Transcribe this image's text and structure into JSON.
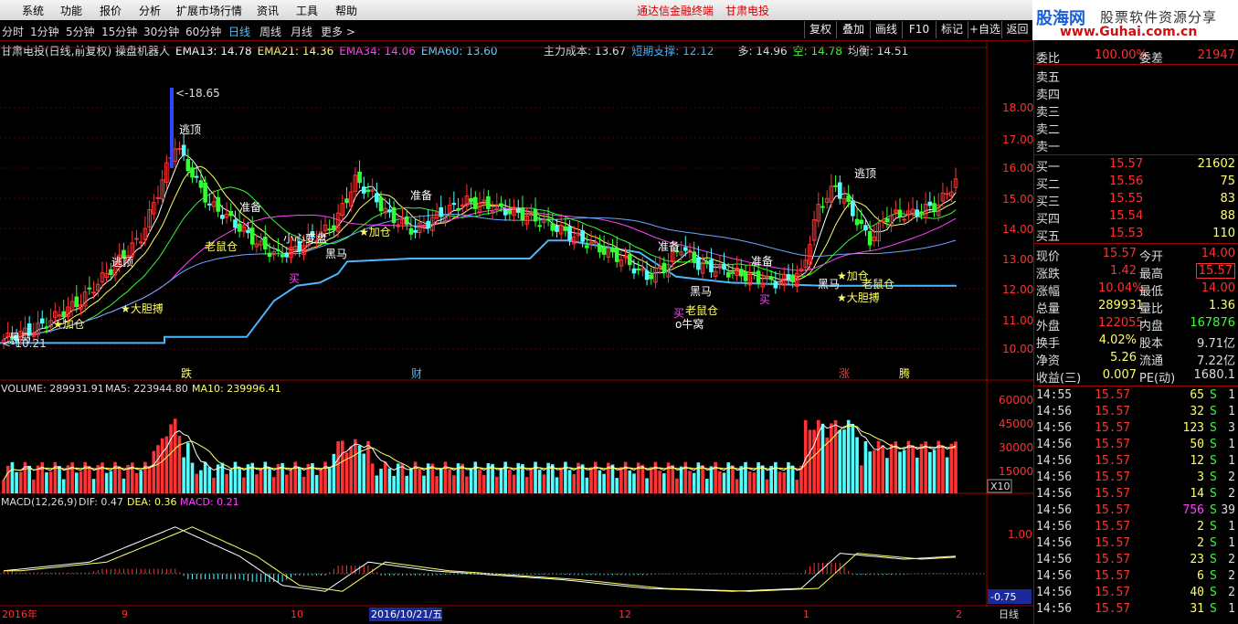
{
  "menu": {
    "items": [
      "系统",
      "功能",
      "报价",
      "分析",
      "扩展市场行情",
      "资讯",
      "工具",
      "帮助"
    ],
    "headline_left": "通达信金融终端",
    "headline_right": "甘肃电投"
  },
  "logo": {
    "brand": "股海网",
    "slogan": "股票软件资源分享",
    "url_text": "www.Guhai.com.cn"
  },
  "timeframes": [
    "分时",
    "1分钟",
    "5分钟",
    "15分钟",
    "30分钟",
    "60分钟",
    "日线",
    "周线",
    "月线",
    "更多 >"
  ],
  "active_timeframe": "日线",
  "toolbar": [
    "复权",
    "叠加",
    "画线",
    "F10",
    "标记",
    "+自选",
    "返回"
  ],
  "chart_header": {
    "title": "甘肃电投(日线,前复权) 操盘机器人",
    "ema13": "EMA13: 14.78",
    "ema21": "EMA21: 14.36",
    "ema34": "EMA34: 14.06",
    "ema60": "EMA60: 13.60",
    "cost": "主力成本: 13.67",
    "support": "短期支撑: 12.12",
    "bull": "多: 14.96",
    "bear": "空: 14.78",
    "balance": "均衡: 14.51"
  },
  "price_axis": [
    "18.00",
    "17.00",
    "16.00",
    "15.00",
    "14.00",
    "13.00",
    "12.00",
    "11.00",
    "10.00"
  ],
  "volume_header": {
    "volume": "VOLUME: 289931.91",
    "ma5": "MA5: 223944.80",
    "ma10": "MA10: 239996.41"
  },
  "volume_axis": [
    "60000",
    "45000",
    "30000",
    "15000"
  ],
  "volume_unit": "X10",
  "macd_header": {
    "name": "MACD(12,26,9)",
    "dif": "DIF: 0.47",
    "dea": "DEA: 0.36",
    "macd": "MACD: 0.21"
  },
  "macd_axis": [
    "1.00"
  ],
  "macd_value_box": "-0.75",
  "date_axis": {
    "year": "2016年",
    "m9": "9",
    "m10": "10",
    "current": "2016/10/21/五",
    "m12": "12",
    "m1": "1",
    "m2": "2",
    "mode": "日线"
  },
  "annotations": {
    "peak": "18.65",
    "low": "10.21",
    "escape1": "逃顶",
    "escape2": "逃顶",
    "escape3": "逃顶",
    "prepare": [
      "准备",
      "准备",
      "准备",
      "准备"
    ],
    "add": [
      "加仓",
      "加仓",
      "加仓"
    ],
    "bold": [
      "大胆搏",
      "大胆搏"
    ],
    "rat": [
      "老鼠仓",
      "老鼠仓",
      "老鼠仓"
    ],
    "horse": [
      "黑马",
      "黑马",
      "黑马",
      "黑马"
    ],
    "careful": "小心变盘",
    "buy": [
      "买",
      "买",
      "买"
    ],
    "nest": "牛窝",
    "bottom_tags": [
      "跌",
      "财",
      "涨",
      "腾"
    ]
  },
  "quote": {
    "wei_bi_label": "委比",
    "wei_bi": "100.00%",
    "wei_cha_label": "委差",
    "wei_cha": "21947",
    "sell": [
      {
        "label": "卖五"
      },
      {
        "label": "卖四"
      },
      {
        "label": "卖三"
      },
      {
        "label": "卖二"
      },
      {
        "label": "卖一"
      }
    ],
    "buy": [
      {
        "label": "买一",
        "price": "15.57",
        "vol": "21602"
      },
      {
        "label": "买二",
        "price": "15.56",
        "vol": "75"
      },
      {
        "label": "买三",
        "price": "15.55",
        "vol": "83"
      },
      {
        "label": "买四",
        "price": "15.54",
        "vol": "88"
      },
      {
        "label": "买五",
        "price": "15.53",
        "vol": "110"
      }
    ],
    "stats": [
      {
        "l1": "现价",
        "v1": "15.57",
        "l2": "今开",
        "v2": "14.00"
      },
      {
        "l1": "涨跌",
        "v1": "1.42",
        "l2": "最高",
        "v2": "15.57"
      },
      {
        "l1": "涨幅",
        "v1": "10.04%",
        "l2": "最低",
        "v2": "14.00"
      },
      {
        "l1": "总量",
        "v1": "289931",
        "l2": "量比",
        "v2": "1.36"
      },
      {
        "l1": "外盘",
        "v1": "122055",
        "l2": "内盘",
        "v2": "167876"
      },
      {
        "l1": "换手",
        "v1": "4.02%",
        "l2": "股本",
        "v2": "9.71亿"
      },
      {
        "l1": "净资",
        "v1": "5.26",
        "l2": "流通",
        "v2": "7.22亿"
      },
      {
        "l1": "收益(三)",
        "v1": "0.007",
        "l2": "PE(动)",
        "v2": "1680.1"
      }
    ]
  },
  "ticks": [
    {
      "t": "14:55",
      "p": "15.57",
      "v": "65",
      "s": "S",
      "n": "1"
    },
    {
      "t": "14:56",
      "p": "15.57",
      "v": "32",
      "s": "S",
      "n": "1"
    },
    {
      "t": "14:56",
      "p": "15.57",
      "v": "123",
      "s": "S",
      "n": "3"
    },
    {
      "t": "14:56",
      "p": "15.57",
      "v": "50",
      "s": "S",
      "n": "1"
    },
    {
      "t": "14:56",
      "p": "15.57",
      "v": "12",
      "s": "S",
      "n": "1"
    },
    {
      "t": "14:56",
      "p": "15.57",
      "v": "3",
      "s": "S",
      "n": "2"
    },
    {
      "t": "14:56",
      "p": "15.57",
      "v": "14",
      "s": "S",
      "n": "2"
    },
    {
      "t": "14:56",
      "p": "15.57",
      "v": "756",
      "s": "S",
      "n": "39"
    },
    {
      "t": "14:56",
      "p": "15.57",
      "v": "2",
      "s": "S",
      "n": "1"
    },
    {
      "t": "14:56",
      "p": "15.57",
      "v": "2",
      "s": "S",
      "n": "1"
    },
    {
      "t": "14:56",
      "p": "15.57",
      "v": "23",
      "s": "S",
      "n": "2"
    },
    {
      "t": "14:56",
      "p": "15.57",
      "v": "6",
      "s": "S",
      "n": "2"
    },
    {
      "t": "14:56",
      "p": "15.57",
      "v": "40",
      "s": "S",
      "n": "2"
    },
    {
      "t": "14:56",
      "p": "15.57",
      "v": "31",
      "s": "S",
      "n": "1"
    }
  ],
  "colors": {
    "up": "#ff3333",
    "down": "#54ffff",
    "support": "#4ab8ff",
    "frame": "#a00000"
  }
}
